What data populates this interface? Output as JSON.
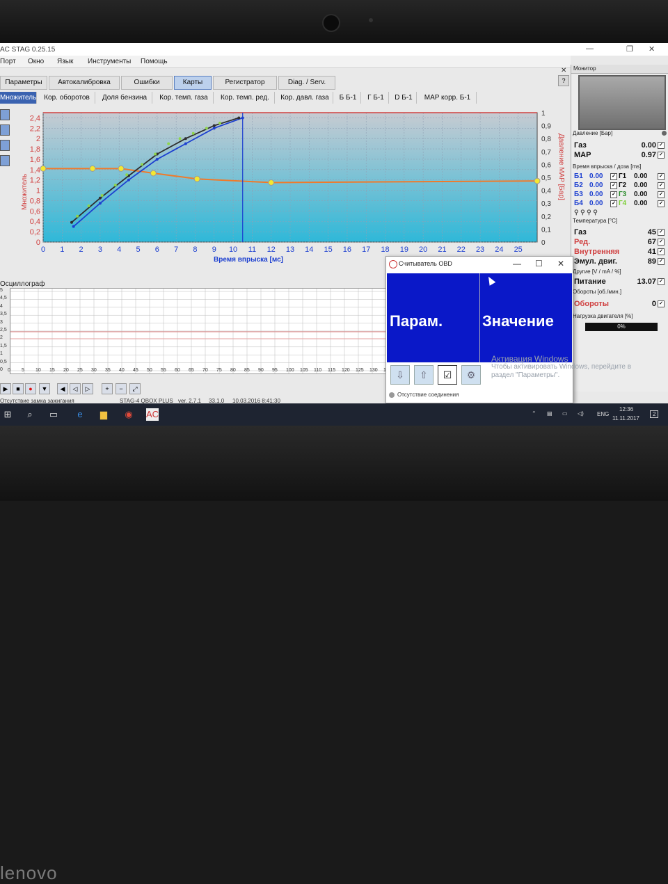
{
  "app": {
    "title": "AC STAG 0.25.15",
    "menu": [
      "Порт",
      "Окно",
      "Язык",
      "Инструменты",
      "Помощь"
    ]
  },
  "tabs": [
    {
      "label": "Параметры",
      "active": false
    },
    {
      "label": "Автокалибровка",
      "active": false
    },
    {
      "label": "Ошибки",
      "active": false
    },
    {
      "label": "Карты",
      "active": true
    },
    {
      "label": "Регистратор",
      "active": false
    },
    {
      "label": "Diag. / Serv.",
      "active": false
    }
  ],
  "subtabs": [
    {
      "label": "Множитель",
      "active": true
    },
    {
      "label": "Кор. оборотов"
    },
    {
      "label": "Доля бензина"
    },
    {
      "label": "Кор. темп. газа"
    },
    {
      "label": "Кор. темп. ред."
    },
    {
      "label": "Кор. давл. газа"
    },
    {
      "label": "Б Б-1"
    },
    {
      "label": "Г Б-1"
    },
    {
      "label": "D Б-1"
    },
    {
      "label": "MAP корр. Б-1"
    }
  ],
  "chart_data": {
    "type": "scatter",
    "xlabel": "Время впрыска [мс]",
    "ylabel": "Множитель",
    "y2label": "Давление MAP [Бар]",
    "xlim": [
      0,
      26
    ],
    "ylim": [
      0,
      2.5
    ],
    "y2lim": [
      0,
      1
    ],
    "xticks": [
      0,
      1,
      2,
      3,
      4,
      5,
      6,
      7,
      8,
      9,
      10,
      11,
      12,
      13,
      14,
      15,
      16,
      17,
      18,
      19,
      20,
      21,
      22,
      23,
      24,
      25
    ],
    "yticks": [
      "0",
      "0,2",
      "0,4",
      "0,6",
      "0,8",
      "1",
      "1,2",
      "1,4",
      "1,6",
      "1,8",
      "2",
      "2,2",
      "2,4"
    ],
    "y2ticks": [
      "0",
      "0,1",
      "0,2",
      "0,3",
      "0,4",
      "0,5",
      "0,6",
      "0,7",
      "0,8",
      "0,9",
      "1"
    ],
    "series": [
      {
        "color": "#f07a2a",
        "kind": "line",
        "x": [
          0,
          2.6,
          4.1,
          5.8,
          8.1,
          12,
          26
        ],
        "y": [
          1.42,
          1.42,
          1.42,
          1.33,
          1.22,
          1.15,
          1.18
        ]
      },
      {
        "color": "#1c3fd0",
        "kind": "line",
        "x": [
          1.6,
          3,
          4.5,
          6,
          7.5,
          9,
          10.5
        ],
        "y": [
          0.3,
          0.75,
          1.2,
          1.6,
          1.9,
          2.2,
          2.4
        ]
      },
      {
        "color": "#2e2e2e",
        "kind": "line",
        "x": [
          1.5,
          3,
          4.5,
          6,
          7.5,
          9,
          10.3
        ],
        "y": [
          0.38,
          0.85,
          1.28,
          1.7,
          2.0,
          2.25,
          2.4
        ]
      },
      {
        "color": "#8fd64a",
        "kind": "points",
        "x": [
          1.8,
          2.4,
          3.1,
          3.8,
          4.4,
          5.2,
          5.9,
          6.6,
          7.2,
          7.9,
          8.6,
          9.3
        ],
        "y": [
          0.5,
          0.7,
          0.9,
          1.1,
          1.3,
          1.5,
          1.7,
          1.9,
          2.0,
          2.1,
          2.2,
          2.3
        ]
      }
    ]
  },
  "oscillo": {
    "title": "Осциллограф",
    "yticks": [
      "5",
      "4,5",
      "4",
      "3,5",
      "3",
      "2,5",
      "2",
      "1,5",
      "1",
      "0,5",
      "0"
    ],
    "xticks": [
      "0",
      "5",
      "10",
      "15",
      "20",
      "25",
      "30",
      "35",
      "40",
      "45",
      "50",
      "55",
      "60",
      "65",
      "70",
      "75",
      "80",
      "85",
      "90",
      "95",
      "100",
      "105",
      "110",
      "115",
      "120",
      "125",
      "130",
      "135"
    ]
  },
  "status": {
    "left": "Отсутствие замка зажигания",
    "device": "STAG-4 QBOX PLUS",
    "version": "ver. 2.7.1",
    "build": "33.1.0",
    "date": "10.03.2016 8:41:30"
  },
  "monitor": {
    "title": "Монитор",
    "pressure_label": "Давление [Бар]",
    "gas_label": "Газ",
    "gas_value": "0.00",
    "map_label": "MAP",
    "map_value": "0.97",
    "inj_label": "Время впрыска / доза [ms]",
    "inj": [
      {
        "b": "Б1",
        "bv": "0.00",
        "g": "Г1",
        "gv": "0.00"
      },
      {
        "b": "Б2",
        "bv": "0.00",
        "g": "Г2",
        "gv": "0.00"
      },
      {
        "b": "Б3",
        "bv": "0.00",
        "g": "Г3",
        "gv": "0.00"
      },
      {
        "b": "Б4",
        "bv": "0.00",
        "g": "Г4",
        "gv": "0.00"
      }
    ],
    "temp_label": "Температура [°C]",
    "temps": [
      {
        "label": "Газ",
        "value": "45",
        "color": "#111"
      },
      {
        "label": "Ред.",
        "value": "67",
        "color": "#d04040"
      },
      {
        "label": "Внутренняя",
        "value": "41",
        "color": "#d04040"
      },
      {
        "label": "Эмул. двиг.",
        "value": "89",
        "color": "#111"
      }
    ],
    "other_label": "Другие [V / mA / %]",
    "power_label": "Питание",
    "power_value": "13.07",
    "rpm_label": "Обороты [об./мин.]",
    "rpm_name": "Обороты",
    "rpm_value": "0",
    "load_label": "Нагрузка двигателя [%]",
    "load_value": "0%",
    "load_fraction": 0
  },
  "obd": {
    "title": "Считыватель OBD",
    "col1": "Парам.",
    "col2": "Значение",
    "status": "Отсутствие соединения"
  },
  "watermark": {
    "line1": "Активация Windows",
    "line2": "Чтобы активировать Windows, перейдите в",
    "line3": "раздел \"Параметры\"."
  },
  "taskbar": {
    "lang": "ENG",
    "time": "12:36",
    "date": "11.11.2017",
    "notif": "2"
  },
  "brand": "lenovo"
}
